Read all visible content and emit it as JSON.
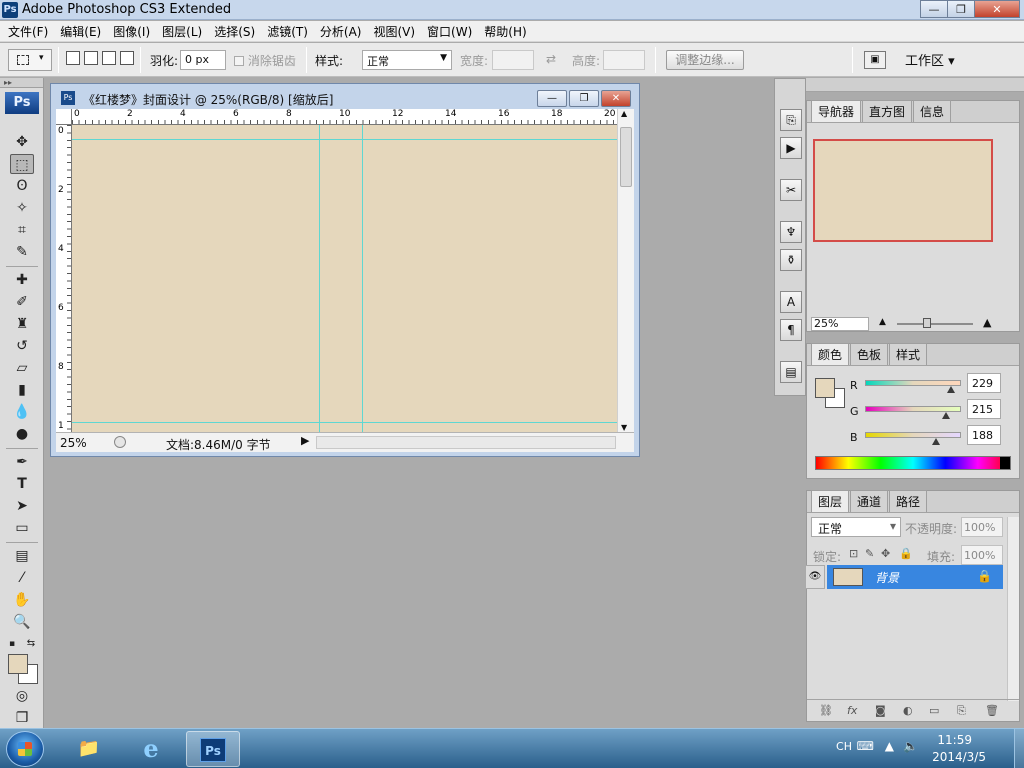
{
  "window": {
    "title": "Adobe Photoshop CS3 Extended",
    "badge": "Ps",
    "min": "—",
    "max": "❐",
    "close": "✕"
  },
  "menu": [
    {
      "label": "文件(F)"
    },
    {
      "label": "编辑(E)"
    },
    {
      "label": "图像(I)"
    },
    {
      "label": "图层(L)"
    },
    {
      "label": "选择(S)"
    },
    {
      "label": "滤镜(T)"
    },
    {
      "label": "分析(A)"
    },
    {
      "label": "视图(V)"
    },
    {
      "label": "窗口(W)"
    },
    {
      "label": "帮助(H)"
    }
  ],
  "options": {
    "feather_label": "羽化:",
    "feather_value": "0 px",
    "antialias_label": "消除锯齿",
    "style_label": "样式:",
    "style_value": "正常",
    "width_label": "宽度:",
    "height_label": "高度:",
    "refine_edge": "调整边缘...",
    "workspace": "工作区 ▾"
  },
  "tools": {
    "logo": "Ps",
    "grip": "▸▸"
  },
  "document": {
    "title": "《红楼梦》封面设计 @ 25%(RGB/8) [缩放后]",
    "icon": "Ps",
    "ruler_h": [
      "0",
      "2",
      "4",
      "6",
      "8",
      "10",
      "12",
      "14",
      "16",
      "18",
      "20"
    ],
    "ruler_v": [
      "0",
      "2",
      "4",
      "6",
      "8",
      "1"
    ],
    "zoom": "25%",
    "doc_info": "文档:8.46M/0 字节",
    "canvas_color": "#e5d7bc",
    "guide_color": "#5fd7d2"
  },
  "navigator": {
    "tabs": [
      {
        "label": "导航器"
      },
      {
        "label": "直方图"
      },
      {
        "label": "信息"
      }
    ],
    "zoom": "25%",
    "frame_color": "#d44c48"
  },
  "color": {
    "tabs": [
      {
        "label": "颜色"
      },
      {
        "label": "色板"
      },
      {
        "label": "样式"
      }
    ],
    "channels": [
      {
        "name": "R",
        "value": "229"
      },
      {
        "name": "G",
        "value": "215"
      },
      {
        "name": "B",
        "value": "188"
      }
    ],
    "foreground": "#e5d7bc",
    "background": "#ffffff"
  },
  "layers": {
    "tabs": [
      {
        "label": "图层"
      },
      {
        "label": "通道"
      },
      {
        "label": "路径"
      }
    ],
    "blend_mode": "正常",
    "opacity_label": "不透明度:",
    "opacity_value": "100%",
    "lock_label": "锁定:",
    "fill_label": "填充:",
    "fill_value": "100%",
    "layer_name": "背景"
  },
  "taskbar": {
    "ime": "CH",
    "time": "11:59",
    "date": "2014/3/5"
  }
}
